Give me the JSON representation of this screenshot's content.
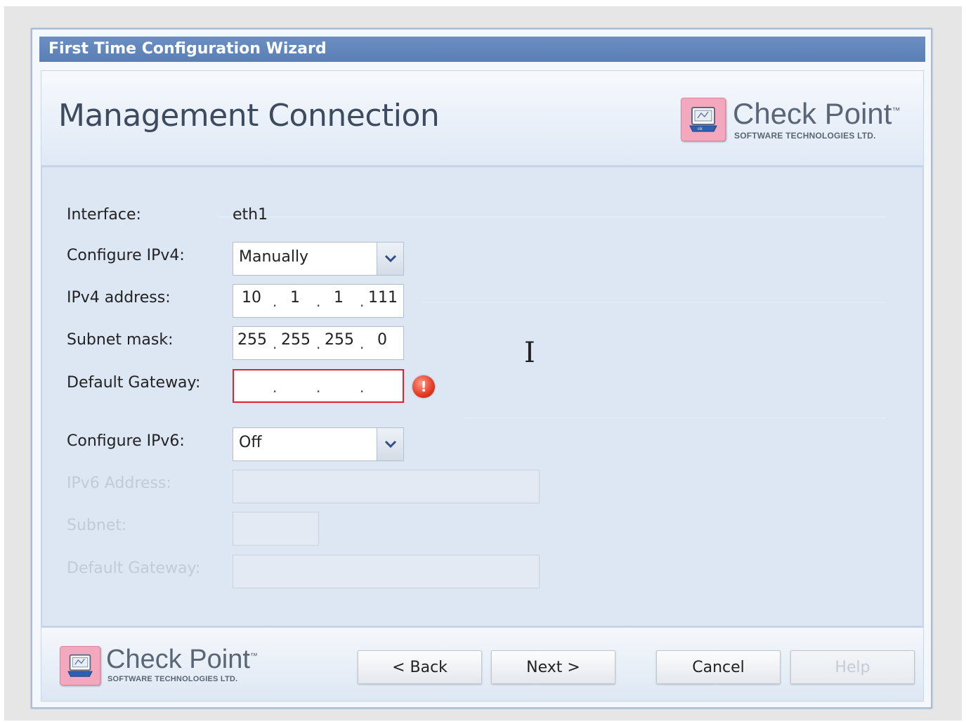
{
  "window": {
    "title": "First Time Configuration Wizard"
  },
  "header": {
    "title": "Management Connection",
    "brand": {
      "name": "Check Point",
      "tm": "™",
      "subtitle": "SOFTWARE TECHNOLOGIES LTD."
    }
  },
  "form": {
    "interface": {
      "label": "Interface:",
      "value": "eth1"
    },
    "configure_ipv4": {
      "label": "Configure IPv4:",
      "value": "Manually"
    },
    "ipv4_address": {
      "label": "IPv4 address:",
      "octets": [
        "10",
        "1",
        "1",
        "111"
      ]
    },
    "subnet_mask": {
      "label": "Subnet mask:",
      "octets": [
        "255",
        "255",
        "255",
        "0"
      ]
    },
    "default_gateway": {
      "label": "Default Gateway:",
      "octets": [
        "",
        "",
        "",
        ""
      ],
      "error": true
    },
    "configure_ipv6": {
      "label": "Configure IPv6:",
      "value": "Off"
    },
    "ipv6_address": {
      "label": "IPv6 Address:",
      "value": ""
    },
    "ipv6_subnet": {
      "label": "Subnet:",
      "value": ""
    },
    "ipv6_gateway": {
      "label": "Default Gateway:",
      "value": ""
    }
  },
  "footer": {
    "brand": {
      "name": "Check Point",
      "tm": "™",
      "subtitle": "SOFTWARE TECHNOLOGIES LTD."
    },
    "buttons": {
      "back": "< Back",
      "next": "Next >",
      "cancel": "Cancel",
      "help": "Help"
    }
  },
  "icons": {
    "dropdown": "chevron-down-icon",
    "error": "error-icon",
    "logo": "checkpoint-logo-icon",
    "cursor": "text-cursor-icon"
  },
  "colors": {
    "titlebar": "#5a7fb5",
    "content_bg": "#dde7f4",
    "error_border": "#e0242e",
    "error_icon": "#e23a22",
    "disabled_text": "#c2cad6"
  }
}
